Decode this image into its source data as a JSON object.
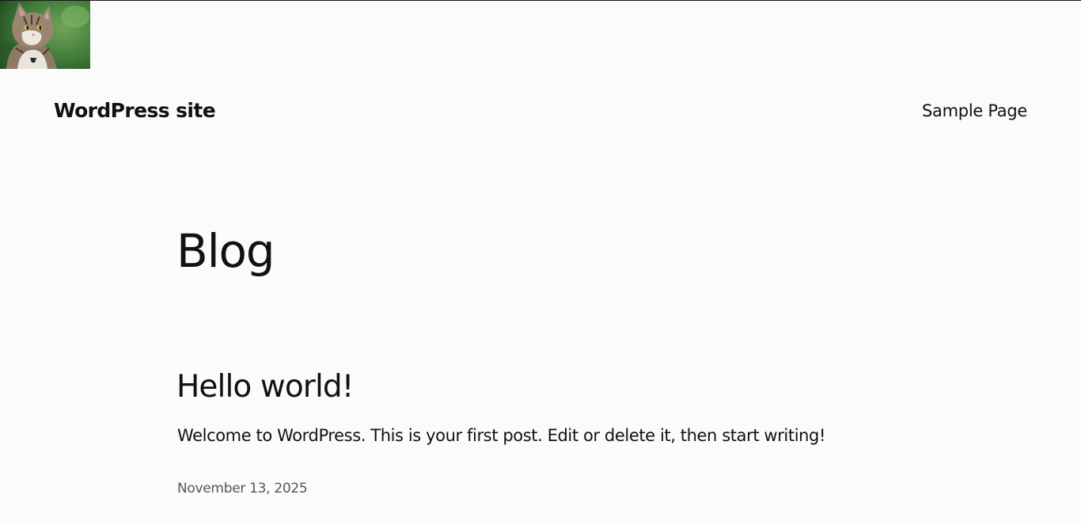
{
  "header": {
    "site_title": "WordPress site",
    "nav": [
      {
        "label": "Sample Page"
      }
    ]
  },
  "main": {
    "page_heading": "Blog",
    "posts": [
      {
        "title": "Hello world!",
        "excerpt": "Welcome to WordPress. This is your first post. Edit or delete it, then start writing!",
        "date": "November 13, 2025"
      }
    ]
  },
  "colors": {
    "background": "#fbfbfb",
    "text": "#111111",
    "muted_text": "#555555"
  }
}
